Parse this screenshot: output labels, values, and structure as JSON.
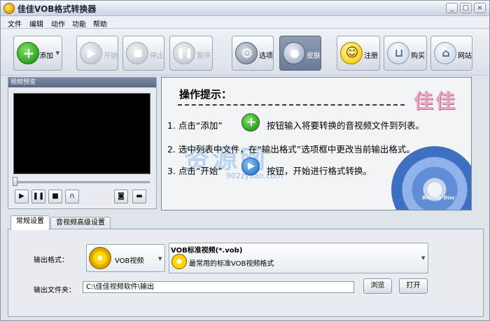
{
  "window": {
    "title": "佳佳VOB格式转换器"
  },
  "titlebar_buttons": [
    "_",
    "□",
    "×"
  ],
  "menu": [
    "文件",
    "编辑",
    "动作",
    "功能",
    "帮助"
  ],
  "toolbar": {
    "add": "添加",
    "start": "开始",
    "stop": "停止",
    "pause": "暂停",
    "options": "选项",
    "skin": "皮肤",
    "register": "注册",
    "buy": "购买",
    "website": "网站"
  },
  "preview": {
    "title": "视频预览"
  },
  "tips": {
    "title": "操作提示：",
    "brand": "佳佳",
    "step1_a": "1. 点击“添加”",
    "step1_b": "按钮输入将要转换的音视频文件到列表。",
    "step2": "2. 选中列表中文件，在“输出格式”选项框中更改当前输出格式。",
    "step3_a": "3. 点击“开始”",
    "step3_b": "按钮，开始进行格式转换。",
    "watermark": "资源网",
    "watermark_url": "902zyuan.com",
    "disc_logo": "Blu-ray Disc"
  },
  "tabs": [
    "常规设置",
    "音视频高级设置"
  ],
  "settings": {
    "output_format_label": "输出格式：",
    "format_name": "VOB视频",
    "format_title": "VOB标准视频(*.vob)",
    "format_desc": "最常用的标准VOB视频格式",
    "output_folder_label": "输出文件夹：",
    "output_folder": "C:\\佳佳视频软件\\输出",
    "browse": "浏览",
    "open": "打开"
  },
  "colors": {
    "accent_green": "#2c9d1e",
    "panel_title": "#5b6a84",
    "brand_pink": "#e9a7c1"
  }
}
